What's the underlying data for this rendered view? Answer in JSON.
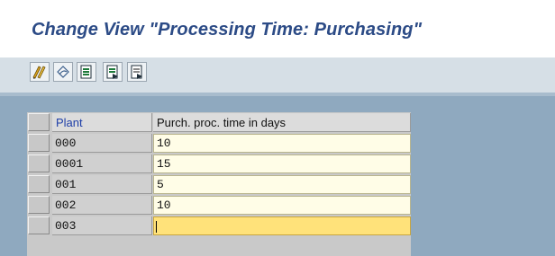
{
  "window": {
    "title": "Change View \"Processing Time: Purchasing\""
  },
  "toolbar": {
    "buttons": [
      {
        "icon": "display-change-icon"
      },
      {
        "icon": "undo-icon"
      },
      {
        "icon": "select-all-icon"
      },
      {
        "icon": "select-block-icon"
      },
      {
        "icon": "deselect-all-icon"
      }
    ]
  },
  "table": {
    "columns": [
      "Plant",
      "Purch. proc. time in days"
    ],
    "rows": [
      {
        "plant": "000",
        "days": "10"
      },
      {
        "plant": "0001",
        "days": "15"
      },
      {
        "plant": "001",
        "days": "5"
      },
      {
        "plant": "002",
        "days": "10"
      },
      {
        "plant": "003",
        "days": ""
      }
    ]
  },
  "colors": {
    "title": "#2c4b86",
    "workarea": "#8fa9bf",
    "input_cell": "#fffde7",
    "active_cell": "#ffe27a"
  }
}
